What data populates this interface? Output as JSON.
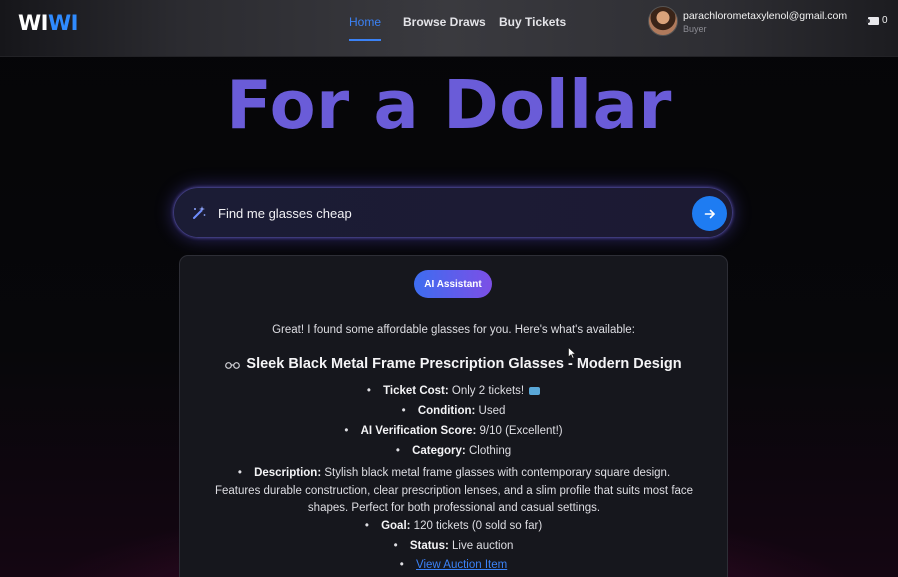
{
  "header": {
    "logo_part1": "WI",
    "logo_part2": "WI",
    "nav": [
      {
        "label": "Home",
        "active": true
      },
      {
        "label": "Browse Draws",
        "active": false
      },
      {
        "label": "Buy Tickets",
        "active": false
      }
    ],
    "user": {
      "email": "parachlorometaxylenol@gmail.com",
      "role": "Buyer"
    },
    "tickets_count": "0"
  },
  "hero": {
    "title": "For a Dollar"
  },
  "search": {
    "query": "Find me glasses cheap",
    "icon": "magic-wand-icon",
    "submit_icon": "arrow-right-icon"
  },
  "assistant": {
    "badge": "AI Assistant",
    "intro": "Great! I found some affordable glasses for you. Here's what's available:",
    "product_icon": "glasses-icon",
    "product_title": "Sleek Black Metal Frame Prescription Glasses - Modern Design",
    "details": [
      {
        "label": "Ticket Cost:",
        "value": "Only 2 tickets!"
      },
      {
        "label": "Condition:",
        "value": "Used"
      },
      {
        "label": "AI Verification Score:",
        "value": "9/10 (Excellent!)"
      },
      {
        "label": "Category:",
        "value": "Clothing"
      },
      {
        "label": "Description:",
        "value": "Stylish black metal frame glasses with contemporary square design. Features durable construction, clear prescription lenses, and a slim profile that suits most face shapes. Perfect for both professional and casual settings."
      },
      {
        "label": "Goal:",
        "value": "120 tickets (0 sold so far)"
      },
      {
        "label": "Status:",
        "value": "Live auction"
      }
    ],
    "link_label": "View Auction Item"
  },
  "colors": {
    "accent": "#3b82f6",
    "hero": "#6a5cd8",
    "background": "#07070a",
    "card": "#16171d"
  }
}
